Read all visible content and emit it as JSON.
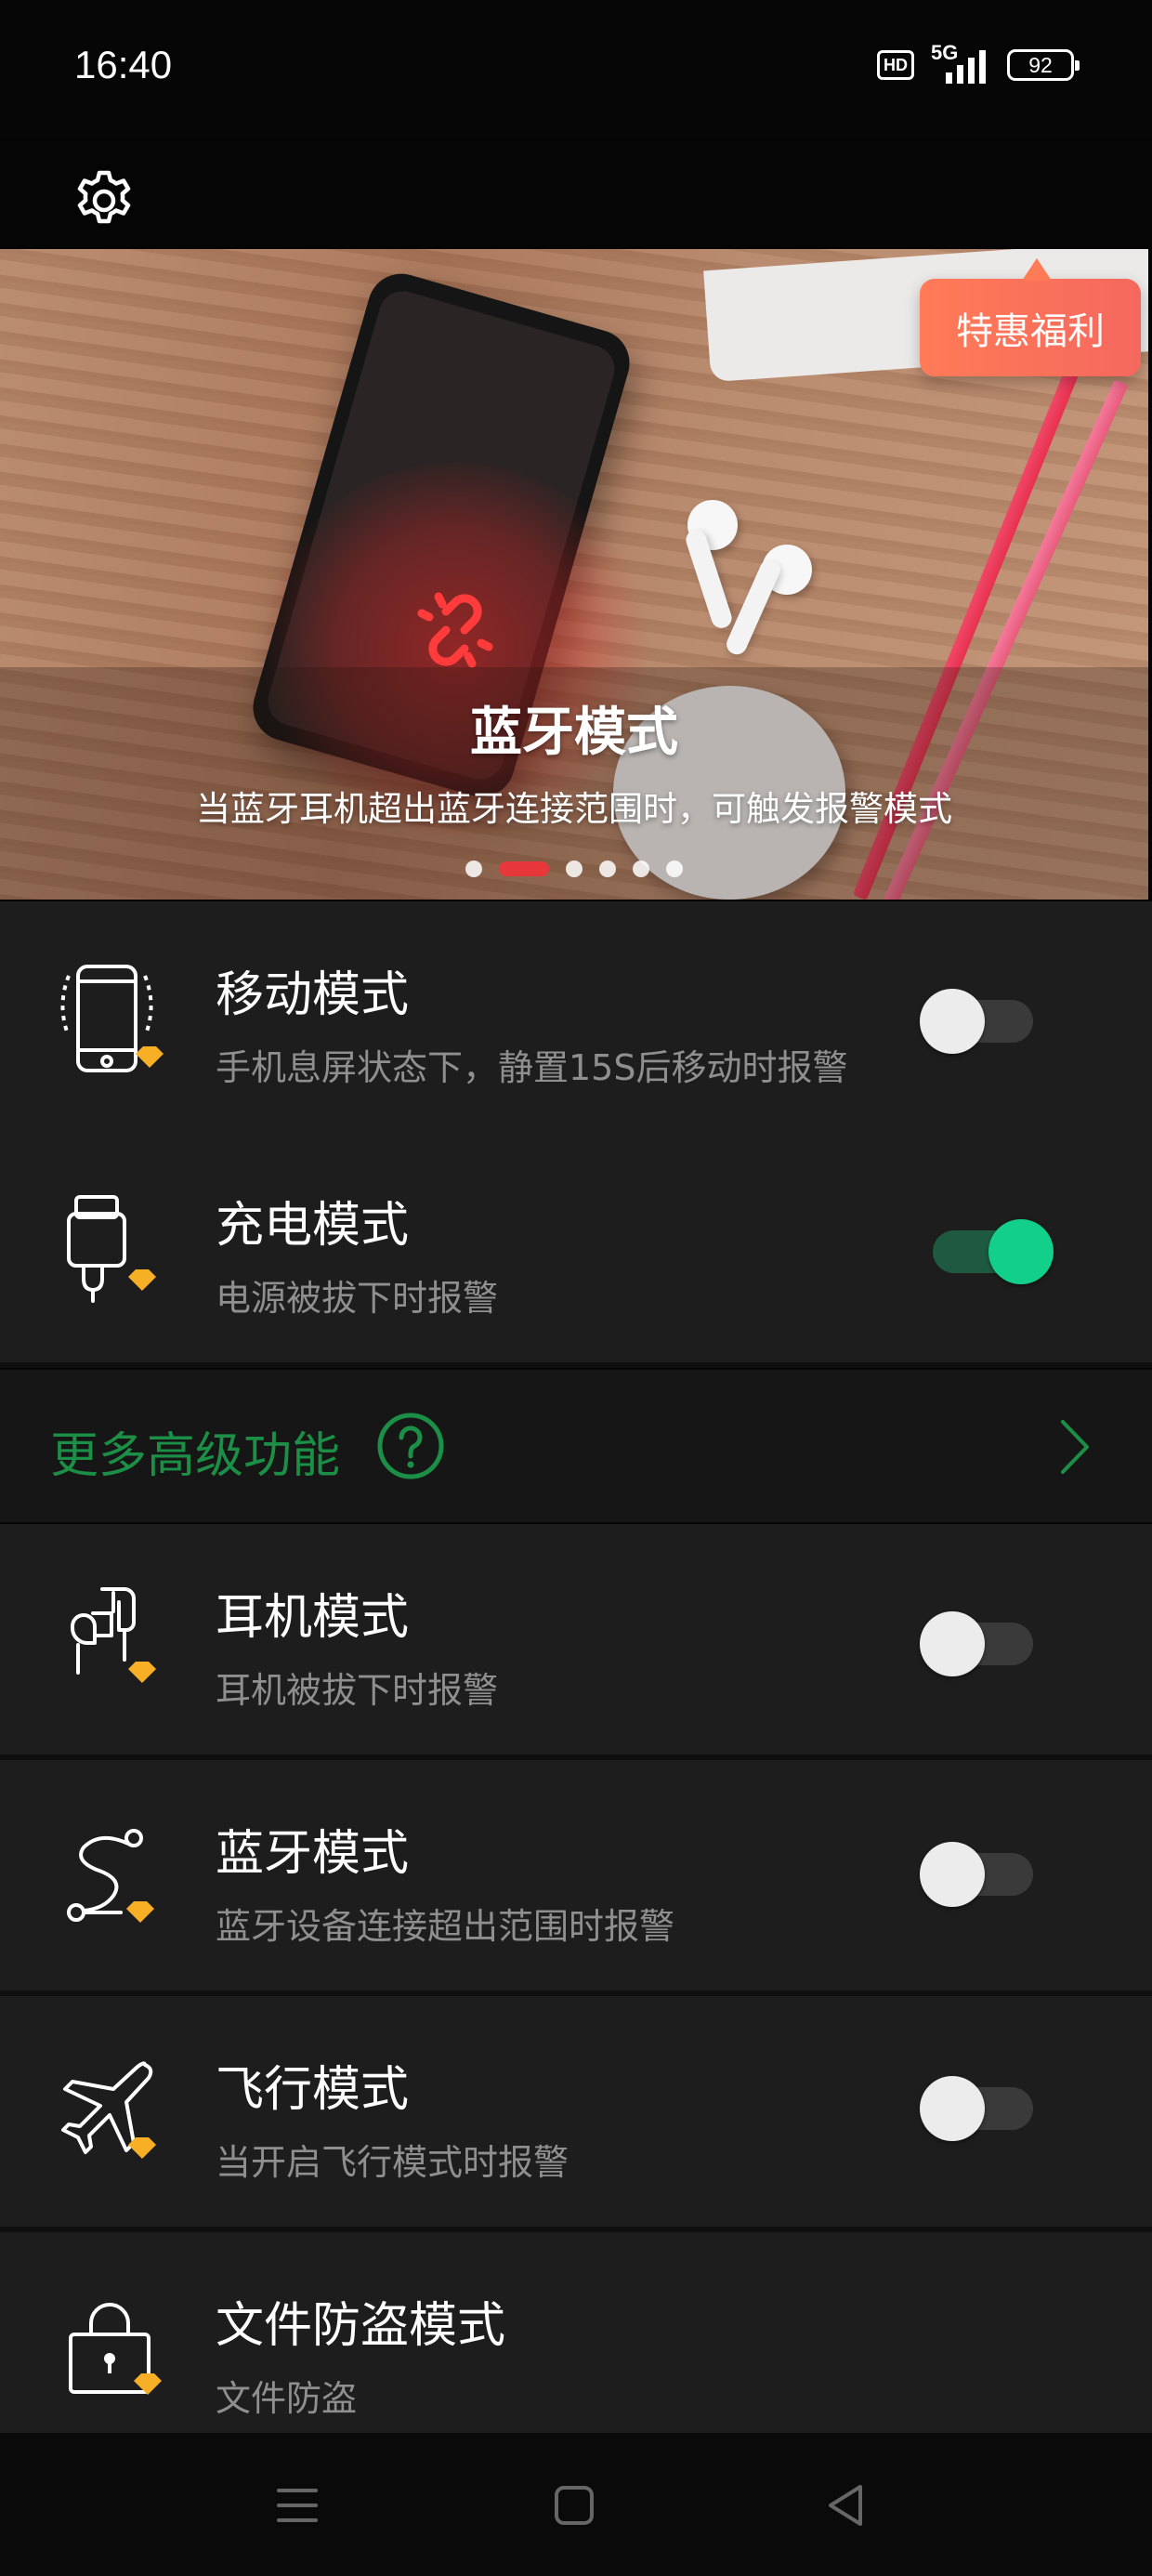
{
  "status_bar": {
    "time": "16:40",
    "hd": "HD",
    "network": "5G",
    "battery": "92"
  },
  "banner": {
    "title": "蓝牙模式",
    "subtitle": "当蓝牙耳机超出蓝牙连接范围时，可触发报警模式",
    "slide_count": 6,
    "active_slide": 2,
    "promo_label": "特惠福利"
  },
  "modes_top": [
    {
      "title": "移动模式",
      "subtitle": "手机息屏状态下，静置15S后移动时报警",
      "enabled": false,
      "icon": "phone-motion-icon"
    },
    {
      "title": "充电模式",
      "subtitle": "电源被拔下时报警",
      "enabled": true,
      "icon": "charger-icon"
    }
  ],
  "more_features": {
    "label": "更多高级功能",
    "accent_color": "#1c8f46"
  },
  "modes_advanced": [
    {
      "title": "耳机模式",
      "subtitle": "耳机被拔下时报警",
      "enabled": false,
      "icon": "earphones-icon"
    },
    {
      "title": "蓝牙模式",
      "subtitle": "蓝牙设备连接超出范围时报警",
      "enabled": false,
      "icon": "bluetooth-range-icon"
    },
    {
      "title": "飞行模式",
      "subtitle": "当开启飞行模式时报警",
      "enabled": false,
      "icon": "airplane-icon"
    },
    {
      "title": "文件防盗模式",
      "subtitle": "文件防盗",
      "icon": "file-lock-icon"
    }
  ],
  "colors": {
    "toggle_on": "#12d08a",
    "promo": "#f5685e",
    "banner_active_dot": "#e8373a"
  }
}
